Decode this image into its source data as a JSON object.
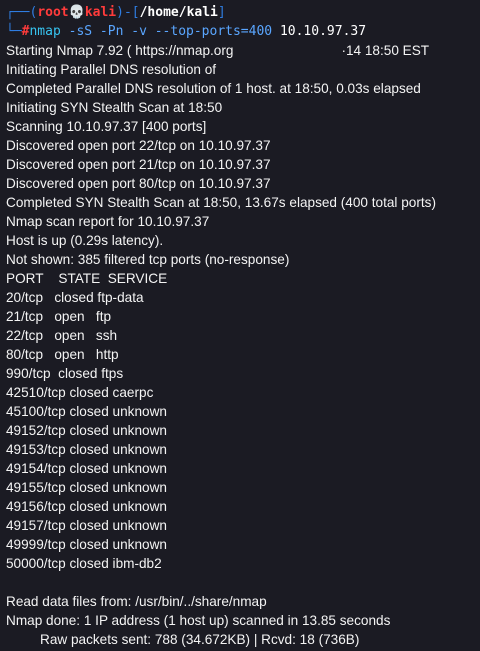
{
  "prompt": {
    "box_top_left": "┌──(",
    "user": "root",
    "skull": "💀",
    "host": "kali",
    "sep": ")-[",
    "path": "/home/kali",
    "close": "]",
    "box_bottom_left": "└─",
    "hash": "#",
    "command": "nmap",
    "flags": " -sS -Pn -v --top-ports=400",
    "target": " 10.10.97.37"
  },
  "output": {
    "starting_a": "Starting Nmap 7.92 ( https://nmap.org",
    "starting_b": "·14 18:50 EST",
    "lines": [
      "Initiating Parallel DNS resolution of",
      "Completed Parallel DNS resolution of 1 host. at 18:50, 0.03s elapsed",
      "Initiating SYN Stealth Scan at 18:50",
      "Scanning 10.10.97.37 [400 ports]",
      "Discovered open port 22/tcp on 10.10.97.37",
      "Discovered open port 21/tcp on 10.10.97.37",
      "Discovered open port 80/tcp on 10.10.97.37",
      "Completed SYN Stealth Scan at 18:50, 13.67s elapsed (400 total ports)",
      "Nmap scan report for 10.10.97.37",
      "Host is up (0.29s latency).",
      "Not shown: 385 filtered tcp ports (no-response)"
    ],
    "port_header": "PORT    STATE  SERVICE",
    "ports": [
      "20/tcp   closed ftp-data",
      "21/tcp   open   ftp",
      "22/tcp   open   ssh",
      "80/tcp   open   http",
      "990/tcp  closed ftps",
      "42510/tcp closed caerpc",
      "45100/tcp closed unknown",
      "49152/tcp closed unknown",
      "49153/tcp closed unknown",
      "49154/tcp closed unknown",
      "49155/tcp closed unknown",
      "49156/tcp closed unknown",
      "49157/tcp closed unknown",
      "49999/tcp closed unknown",
      "50000/tcp closed ibm-db2"
    ],
    "read_data": "Read data files from: /usr/bin/../share/nmap",
    "done": "Nmap done: 1 IP address (1 host up) scanned in 13.85 seconds",
    "raw_packets": "Raw packets sent: 788 (34.672KB) | Rcvd: 18 (736B)"
  },
  "colors": {
    "background": "#1b1b23",
    "prompt_frame": "#2f7de1",
    "prompt_user": "#ff3b3b",
    "command": "#37c4f0",
    "text": "#f4f4f4"
  }
}
